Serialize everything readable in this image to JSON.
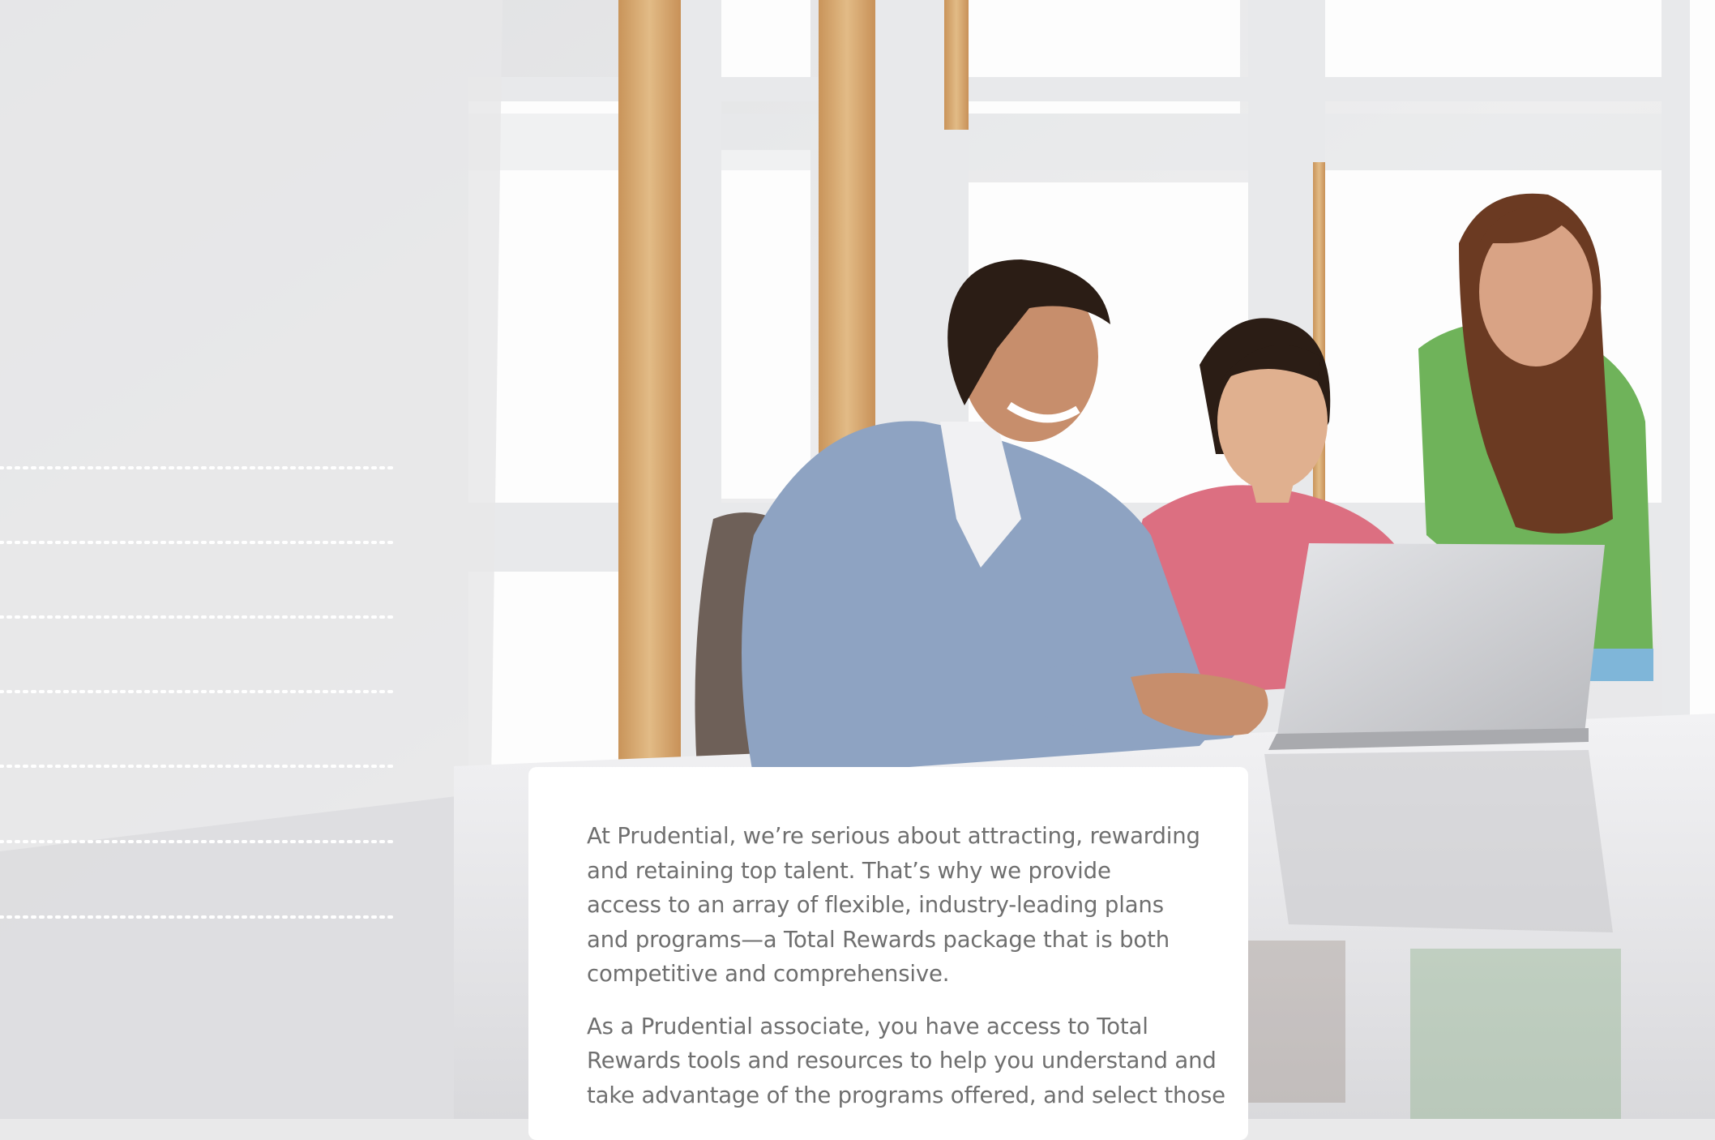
{
  "photo": {
    "description_icon": "photo-of-people-at-laptop",
    "colors": {
      "wall": "#eeeeef",
      "window_frame": "#f3f3f4",
      "wood": "#d9ae76",
      "sweater": "#8ea3c2",
      "pink_shirt": "#dc6f81",
      "green_top": "#6fb35a",
      "laptop": "#cfd0d3",
      "skin": "#c78e6c",
      "hair_dark": "#2b1d15",
      "hair_brown": "#6b3a22"
    }
  },
  "card": {
    "paragraph1": {
      "lines": [
        "At Prudential, we’re serious about attracting, rewarding",
        "and retaining top talent. That’s why we provide",
        "access to an array of flexible, industry-leading plans",
        "and programs—a Total Rewards package that is both",
        "competitive and comprehensive."
      ]
    },
    "paragraph2": {
      "lines": [
        "As a Prudential associate, you have access to Total",
        "Rewards tools and resources to help you understand and",
        "take advantage of the programs offered, and select those"
      ]
    }
  },
  "dotted_lines": {
    "count": 7,
    "color": "#ffffff"
  }
}
